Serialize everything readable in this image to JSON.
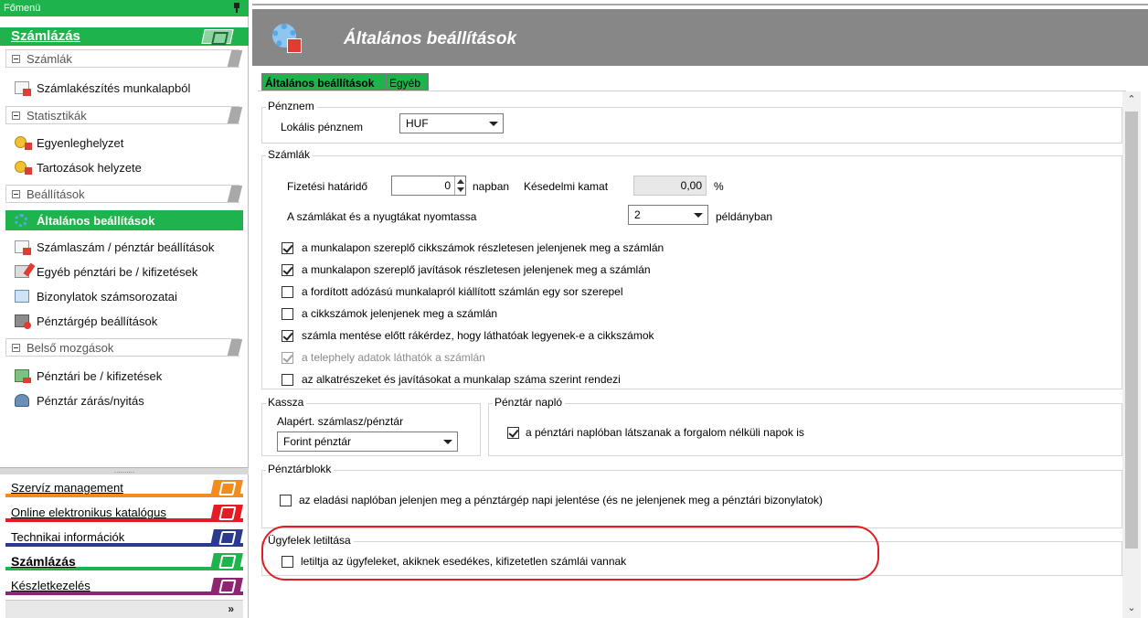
{
  "sidebar": {
    "title": "Főmenü",
    "header": "Számlázás",
    "groups": [
      {
        "label": "Számlák"
      },
      {
        "label": "Statisztikák"
      },
      {
        "label": "Beállítások"
      },
      {
        "label": "Belső mozgások"
      }
    ],
    "items": [
      {
        "label": "Számlakészítés munkalapból",
        "icon": "invoice-icon"
      },
      {
        "label": "Egyenleghelyzet",
        "icon": "coin-icon"
      },
      {
        "label": "Tartozások helyzete",
        "icon": "debt-icon"
      },
      {
        "label": "Általános beállítások",
        "icon": "gear-icon",
        "active": true
      },
      {
        "label": "Számlaszám / pénztár beállítások",
        "icon": "invoice-settings-icon"
      },
      {
        "label": "Egyéb pénztári be / kifizetések",
        "icon": "ledger-icon"
      },
      {
        "label": "Bizonylatok számsorozatai",
        "icon": "book-icon"
      },
      {
        "label": "Pénztárgép beállítások",
        "icon": "cash-register-icon"
      },
      {
        "label": "Pénztári be / kifizetések",
        "icon": "transfer-icon"
      },
      {
        "label": "Pénztár zárás/nyitás",
        "icon": "people-icon"
      }
    ],
    "grip": "..........",
    "nav": [
      {
        "label": "Szervíz management",
        "color": "#f28c1e"
      },
      {
        "label": "Online elektronikus katalógus",
        "color": "#e31b23"
      },
      {
        "label": "Technikai információk",
        "color": "#2b3a8f"
      },
      {
        "label": "Számlázás",
        "color": "#1fb34d",
        "bold": true
      },
      {
        "label": "Készletkezelés",
        "color": "#8e2572"
      }
    ],
    "more": "»"
  },
  "main": {
    "title": "Általános beállítások",
    "tabs": [
      "Általános beállítások",
      "Egyéb"
    ],
    "penznem": {
      "legend": "Pénznem",
      "label": "Lokális pénznem",
      "value": "HUF"
    },
    "szamlak": {
      "legend": "Számlák",
      "fizetesi_label": "Fizetési határidő",
      "fizetesi_value": "0",
      "napban": "napban",
      "kesedelmi_label": "Késedelmi kamat",
      "kesedelmi_value": "0,00",
      "percent": "%",
      "nyomtassa_label": "A számlákat és a nyugtákat nyomtassa",
      "nyomtassa_value": "2",
      "peldanyban": "példányban",
      "checks": [
        {
          "label": "a munkalapon szereplő cikkszámok részletesen jelenjenek meg a számlán",
          "checked": true
        },
        {
          "label": "a munkalapon szereplő javítások részletesen jelenjenek meg a számlán",
          "checked": true
        },
        {
          "label": "a fordított adózású munkalapról kiállított számlán egy sor szerepel",
          "checked": false
        },
        {
          "label": "a cikkszámok jelenjenek meg a számlán",
          "checked": false
        },
        {
          "label": "számla mentése előtt rákérdez, hogy láthatóak legyenek-e a cikkszámok",
          "checked": true
        },
        {
          "label": "a telephely adatok láthatók a számlán",
          "checked": true,
          "disabled": true
        },
        {
          "label": "az alkatrészeket és javításokat a munkalap száma szerint rendezi",
          "checked": false
        }
      ]
    },
    "kassza": {
      "legend": "Kassza",
      "label": "Alapért. számlasz/pénztár",
      "value": "Forint pénztár"
    },
    "penztar_naplo": {
      "legend": "Pénztár napló",
      "check_label": "a pénztári naplóban látszanak a forgalom nélküli napok is",
      "checked": true
    },
    "penztarblokk": {
      "legend": "Pénztárblokk",
      "check_label": "az eladási naplóban jelenjen meg a pénztárgép napi jelentése (és ne jelenjenek meg a pénztári bizonylatok)",
      "checked": false
    },
    "ugyfelek": {
      "legend": "Ügyfelek letiltása",
      "check_label": "letiltja az ügyfeleket, akiknek esedékes, kifizetetlen számlái vannak",
      "checked": false
    }
  },
  "colors": {
    "accent_green": "#1fb34d",
    "header_gray": "#878787",
    "highlight_red": "#e31b23"
  }
}
